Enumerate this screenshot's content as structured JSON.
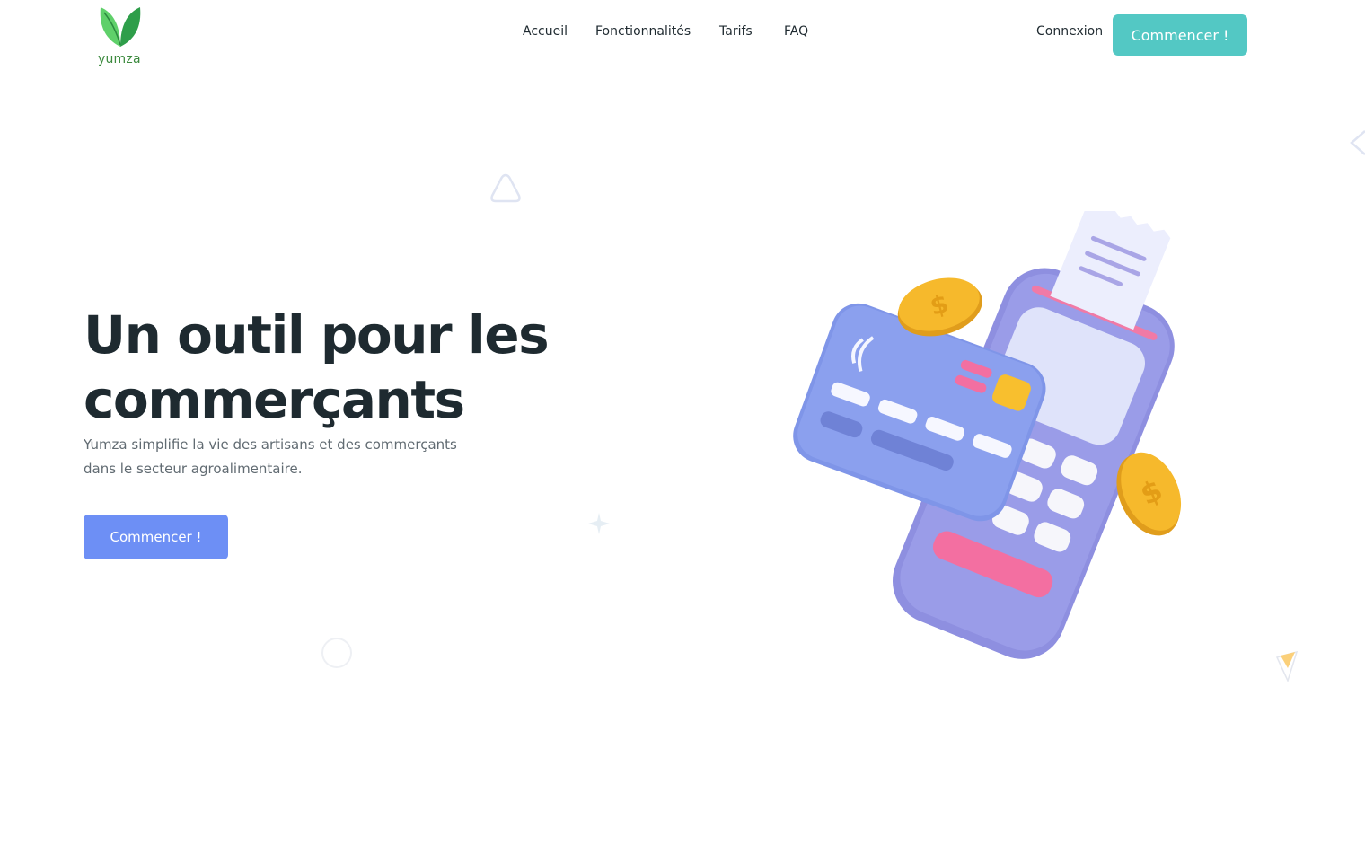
{
  "brand": {
    "name": "yumza",
    "logo_icon": "leaf-logo-icon",
    "colors": {
      "leaf_light": "#5fd06a",
      "leaf_dark": "#2e9e4a",
      "text": "#3c8a3e"
    }
  },
  "nav": {
    "items": [
      {
        "label": "Accueil"
      },
      {
        "label": "Fonctionnalités"
      },
      {
        "label": "Tarifs"
      },
      {
        "label": "FAQ"
      }
    ],
    "login_label": "Connexion",
    "cta_label": "Commencer !"
  },
  "hero": {
    "title_line1": "Un outil pour les",
    "title_line2": "commerçants",
    "subtitle_line1": "Yumza simplifie la vie des artisans et des commerçants",
    "subtitle_line2": "dans le secteur agroalimentaire.",
    "cta_label": "Commencer !"
  },
  "colors": {
    "accent_teal": "#53c8c4",
    "accent_blue": "#6d8ff5",
    "heading": "#1e2a30",
    "body_text": "#616b72"
  },
  "illustration": {
    "icon": "payment-terminal-illustration",
    "elements": [
      "card-reader",
      "credit-card",
      "receipt",
      "dollar-coin",
      "dollar-coin"
    ]
  }
}
